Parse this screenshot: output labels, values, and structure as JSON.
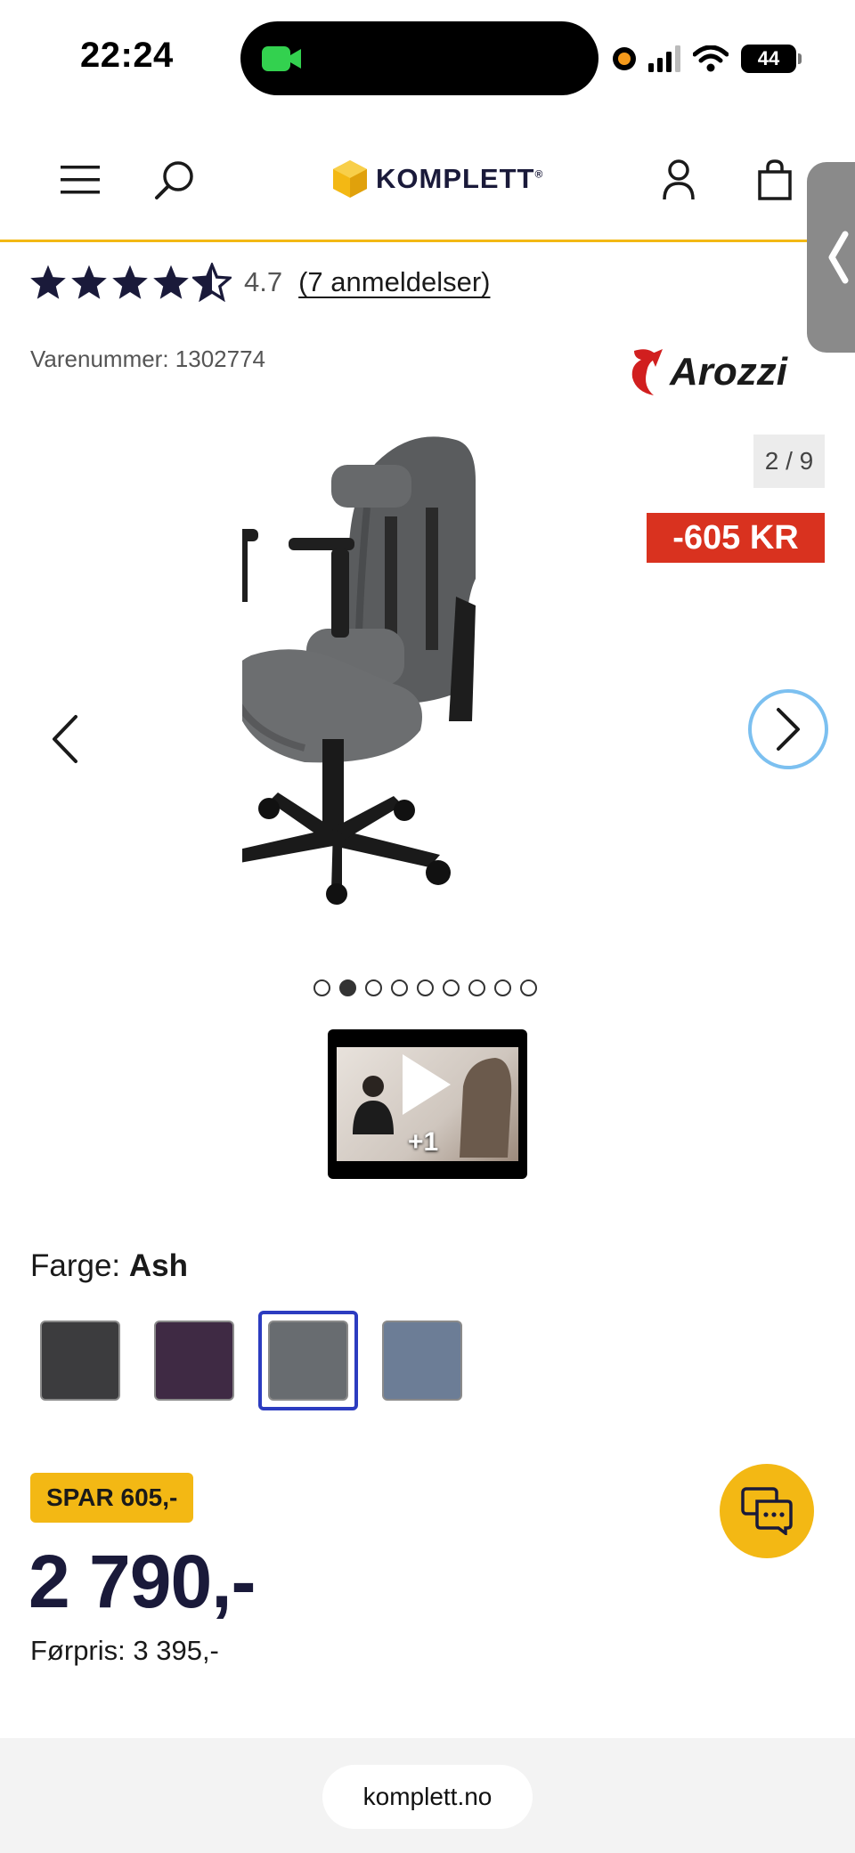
{
  "status_bar": {
    "time": "22:24",
    "battery": "44"
  },
  "header": {
    "logo_text": "KOMPLETT"
  },
  "product": {
    "rating_value": "4.7",
    "reviews_link": "(7 anmeldelser)",
    "sku": "Varenummer: 1302774",
    "brand": "Arozzi"
  },
  "gallery": {
    "counter": "2 / 9",
    "discount_badge": "-605 KR",
    "dot_count": 9,
    "active_dot": 1,
    "video_plus": "+1"
  },
  "color": {
    "label": "Farge:",
    "selected": "Ash",
    "swatches": [
      {
        "name": "dark-grey",
        "hex": "#3c3c3e"
      },
      {
        "name": "purple",
        "hex": "#3f2a44"
      },
      {
        "name": "ash",
        "hex": "#686c70"
      },
      {
        "name": "blue-grey",
        "hex": "#6c7d96"
      }
    ]
  },
  "price": {
    "save_badge": "SPAR 605,-",
    "current": "2 790,-",
    "previous": "Førpris: 3 395,-"
  },
  "browser": {
    "url": "komplett.no"
  },
  "colors": {
    "accent": "#f3b814",
    "discount": "#d9321f",
    "selected_border": "#2c3cc0"
  }
}
